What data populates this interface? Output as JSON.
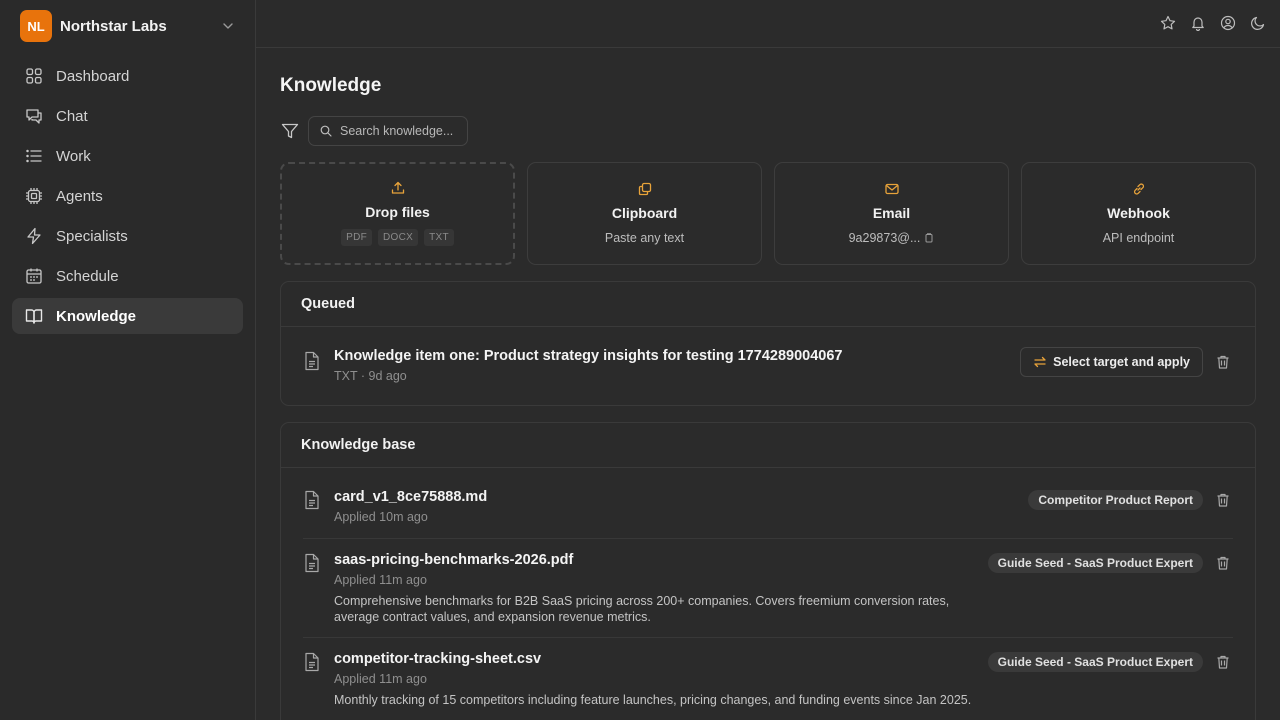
{
  "org": {
    "initials": "NL",
    "name": "Northstar Labs",
    "accent": "#e8730c"
  },
  "nav": [
    {
      "label": "Dashboard",
      "icon": "grid-icon"
    },
    {
      "label": "Chat",
      "icon": "chat-icon"
    },
    {
      "label": "Work",
      "icon": "list-icon"
    },
    {
      "label": "Agents",
      "icon": "cpu-icon"
    },
    {
      "label": "Specialists",
      "icon": "bolt-icon"
    },
    {
      "label": "Schedule",
      "icon": "calendar-icon"
    },
    {
      "label": "Knowledge",
      "icon": "book-icon",
      "active": true
    }
  ],
  "topbar": {
    "icons": [
      "star-icon",
      "bell-icon",
      "user-icon",
      "moon-icon"
    ]
  },
  "page": {
    "title": "Knowledge"
  },
  "search": {
    "placeholder": "Search knowledge..."
  },
  "sources": {
    "drop": {
      "title": "Drop files",
      "formats": [
        "PDF",
        "DOCX",
        "TXT"
      ]
    },
    "clipboard": {
      "title": "Clipboard",
      "subtitle": "Paste any text"
    },
    "email": {
      "title": "Email",
      "subtitle": "9a29873@..."
    },
    "webhook": {
      "title": "Webhook",
      "subtitle": "API endpoint"
    }
  },
  "queued": {
    "heading": "Queued",
    "items": [
      {
        "title": "Knowledge item one: Product strategy insights for testing 1774289004067",
        "meta": "TXT · 9d ago",
        "action": "Select target and apply"
      }
    ]
  },
  "knowledge_base": {
    "heading": "Knowledge base",
    "items": [
      {
        "title": "card_v1_8ce75888.md",
        "meta": "Applied 10m ago",
        "tag": "Competitor Product Report",
        "desc": ""
      },
      {
        "title": "saas-pricing-benchmarks-2026.pdf",
        "meta": "Applied 11m ago",
        "tag": "Guide Seed - SaaS Product Expert",
        "desc": "Comprehensive benchmarks for B2B SaaS pricing across 200+ companies. Covers freemium conversion rates, average contract values, and expansion revenue metrics."
      },
      {
        "title": "competitor-tracking-sheet.csv",
        "meta": "Applied 11m ago",
        "tag": "Guide Seed - SaaS Product Expert",
        "desc": "Monthly tracking of 15 competitors including feature launches, pricing changes, and funding events since Jan 2025."
      }
    ]
  }
}
